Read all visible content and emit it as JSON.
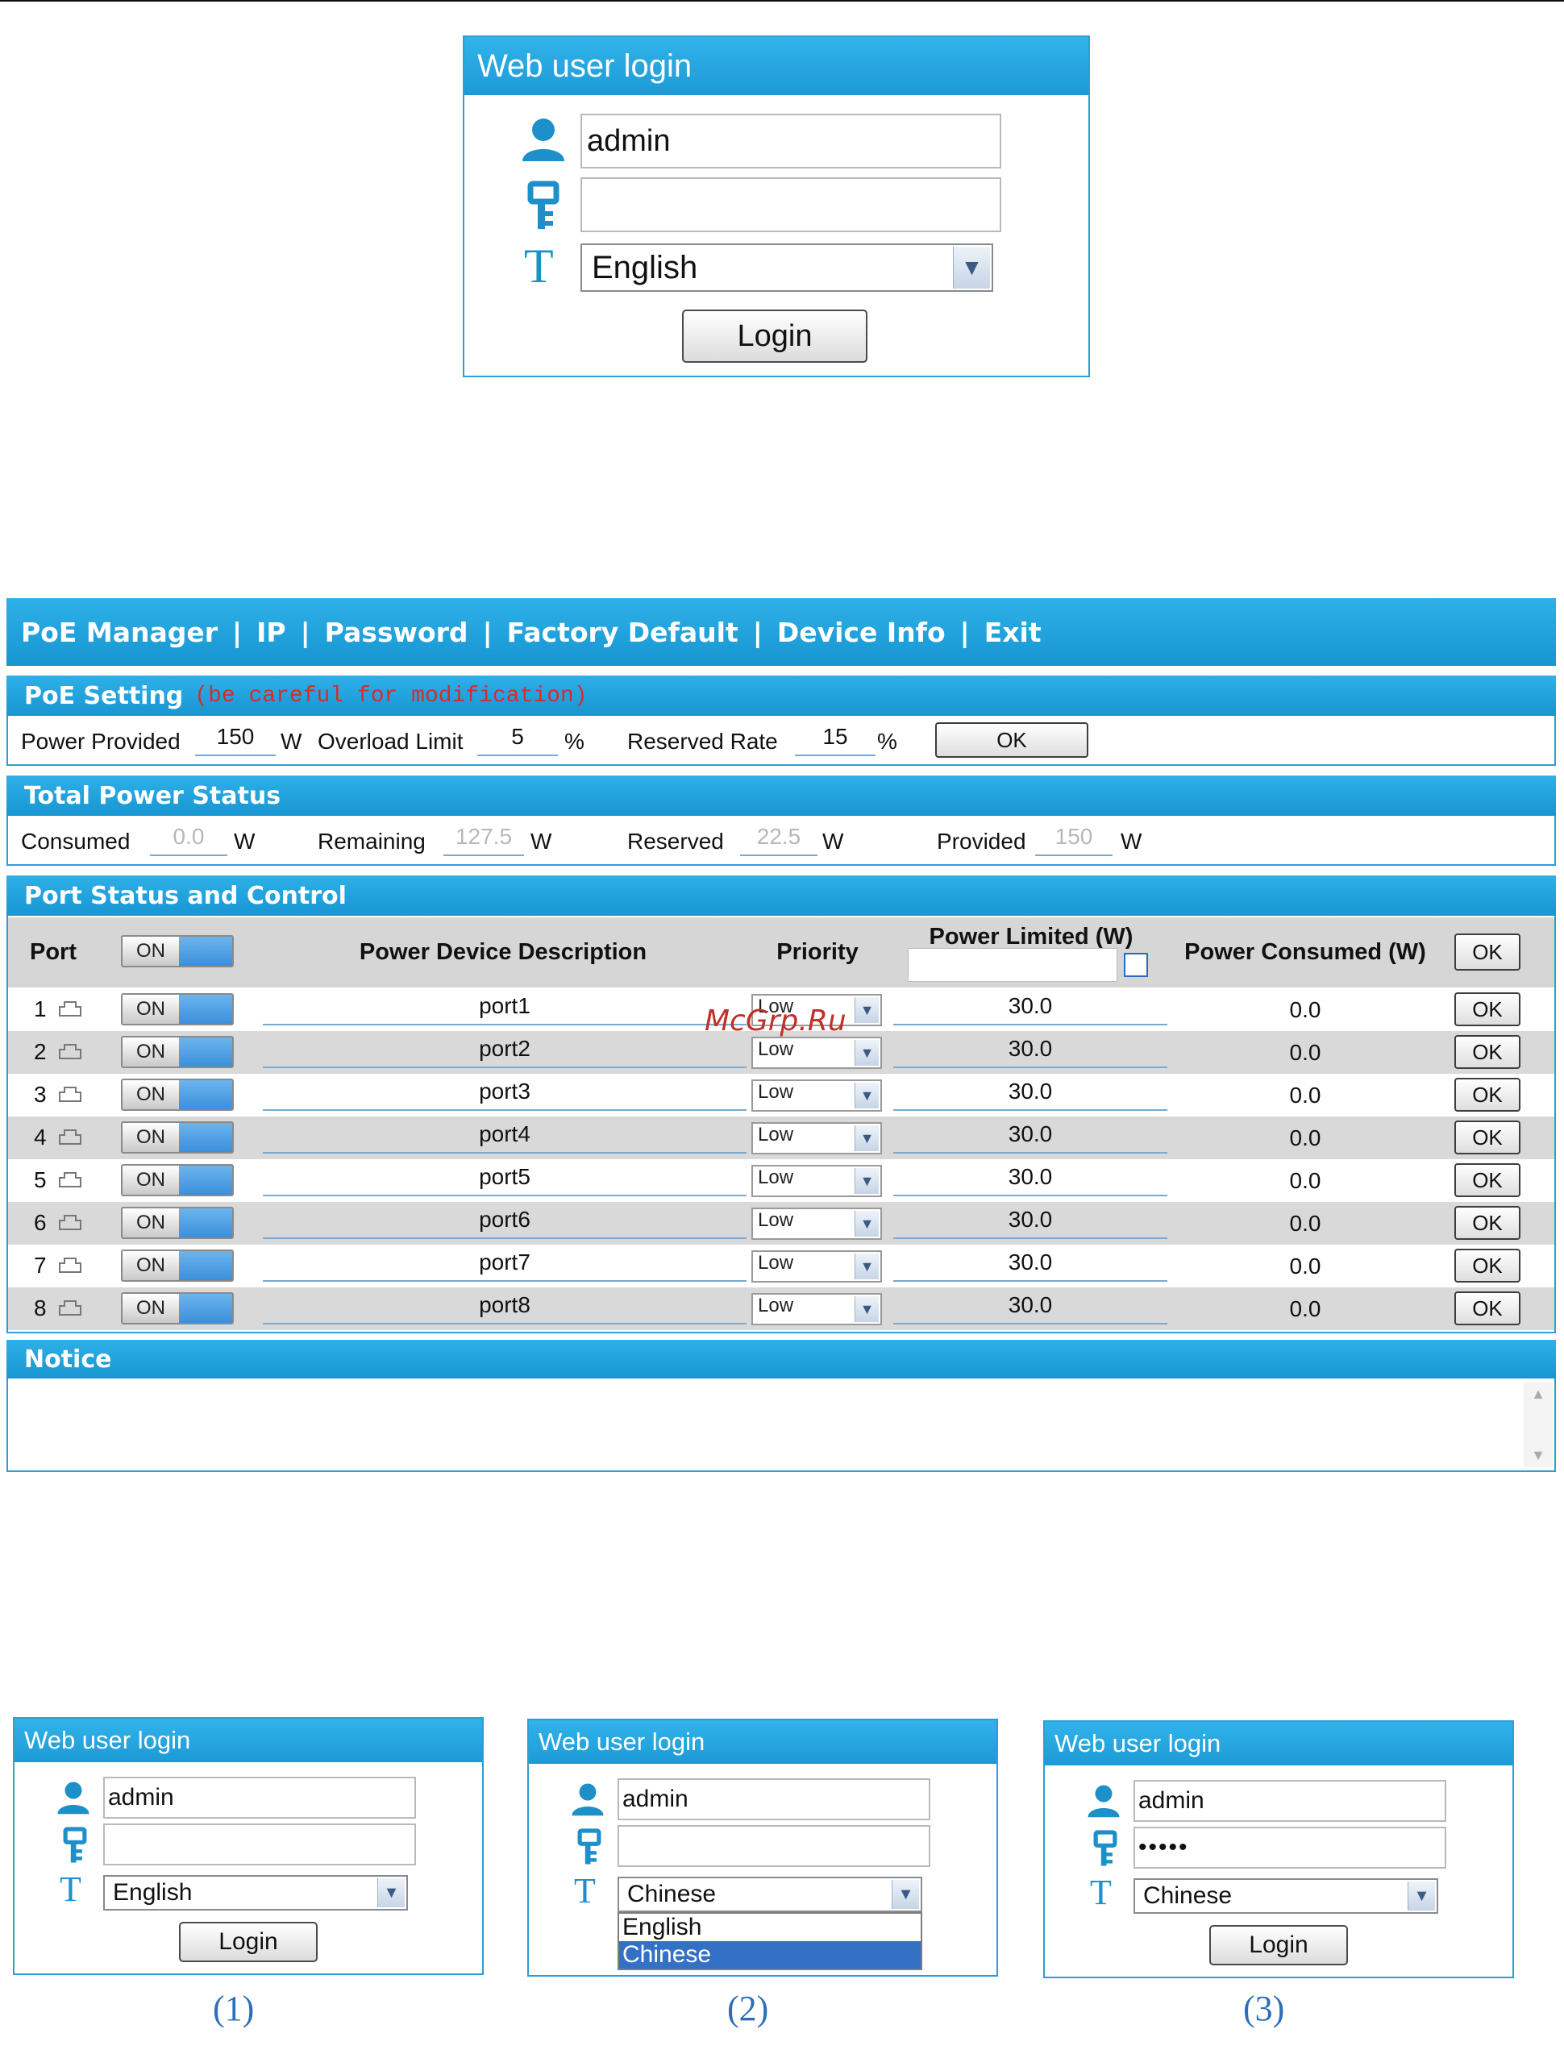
{
  "login_main": {
    "title": "Web user login",
    "username": "admin",
    "password": "",
    "language": "English",
    "login_button": "Login"
  },
  "navbar": {
    "items": [
      "PoE Manager",
      "IP",
      "Password",
      "Factory Default",
      "Device Info",
      "Exit"
    ],
    "separator": "|"
  },
  "poe_setting": {
    "title": "PoE Setting",
    "warning": "(be careful for modification)",
    "power_provided_label": "Power Provided",
    "power_provided_value": "150",
    "power_unit": "W",
    "overload_label": "Overload Limit",
    "overload_value": "5",
    "percent_unit": "%",
    "reserved_rate_label": "Reserved Rate",
    "reserved_rate_value": "15",
    "ok_label": "OK"
  },
  "total_status": {
    "title": "Total Power Status",
    "consumed_label": "Consumed",
    "consumed_value": "0.0",
    "remaining_label": "Remaining",
    "remaining_value": "127.5",
    "reserved_label": "Reserved",
    "reserved_value": "22.5",
    "provided_label": "Provided",
    "provided_value": "150",
    "unit": "W"
  },
  "port_control": {
    "title": "Port Status and Control",
    "headers": {
      "port": "Port",
      "toggle": "ON",
      "description": "Power Device Description",
      "priority": "Priority",
      "power_limited": "Power Limited (W)",
      "power_consumed": "Power Consumed (W)",
      "ok": "OK"
    },
    "rows": [
      {
        "port": "1",
        "state": "ON",
        "description": "port1",
        "priority": "Low",
        "limit": "30.0",
        "consumed": "0.0",
        "ok": "OK"
      },
      {
        "port": "2",
        "state": "ON",
        "description": "port2",
        "priority": "Low",
        "limit": "30.0",
        "consumed": "0.0",
        "ok": "OK"
      },
      {
        "port": "3",
        "state": "ON",
        "description": "port3",
        "priority": "Low",
        "limit": "30.0",
        "consumed": "0.0",
        "ok": "OK"
      },
      {
        "port": "4",
        "state": "ON",
        "description": "port4",
        "priority": "Low",
        "limit": "30.0",
        "consumed": "0.0",
        "ok": "OK"
      },
      {
        "port": "5",
        "state": "ON",
        "description": "port5",
        "priority": "Low",
        "limit": "30.0",
        "consumed": "0.0",
        "ok": "OK"
      },
      {
        "port": "6",
        "state": "ON",
        "description": "port6",
        "priority": "Low",
        "limit": "30.0",
        "consumed": "0.0",
        "ok": "OK"
      },
      {
        "port": "7",
        "state": "ON",
        "description": "port7",
        "priority": "Low",
        "limit": "30.0",
        "consumed": "0.0",
        "ok": "OK"
      },
      {
        "port": "8",
        "state": "ON",
        "description": "port8",
        "priority": "Low",
        "limit": "30.0",
        "consumed": "0.0",
        "ok": "OK"
      }
    ]
  },
  "notice": {
    "title": "Notice",
    "text": ""
  },
  "watermark": "McGrp.Ru",
  "login_steps": [
    {
      "title": "Web user login",
      "username": "admin",
      "password": "",
      "language": "English",
      "login_button": "Login",
      "caption": "(1)"
    },
    {
      "title": "Web user login",
      "username": "admin",
      "password": "",
      "language": "Chinese",
      "options": [
        "English",
        "Chinese"
      ],
      "caption": "(2)"
    },
    {
      "title": "Web user login",
      "username": "admin",
      "password": "•••••",
      "language": "Chinese",
      "login_button": "Login",
      "caption": "(3)"
    }
  ],
  "colors": {
    "header_blue": "#1c9ad6",
    "warning_red": "#d62b2b",
    "row_gray": "#d9d9d9",
    "selected_option": "#3470c4"
  },
  "icons": [
    "user-icon",
    "key-icon",
    "language-t-icon",
    "chevron-down-icon",
    "port-plug-icon"
  ]
}
